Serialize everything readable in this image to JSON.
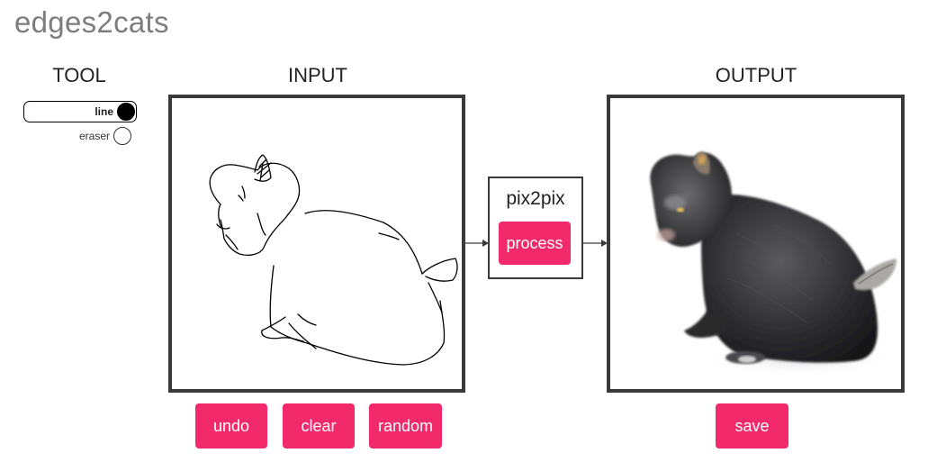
{
  "app": {
    "title": "edges2cats"
  },
  "tool": {
    "label": "TOOL",
    "options": [
      {
        "label": "line",
        "selected": true
      },
      {
        "label": "eraser",
        "selected": false
      }
    ]
  },
  "input": {
    "label": "INPUT",
    "buttons": {
      "undo": "undo",
      "clear": "clear",
      "random": "random"
    }
  },
  "model": {
    "label": "pix2pix",
    "process_button": "process"
  },
  "output": {
    "label": "OUTPUT",
    "save_button": "save"
  },
  "colors": {
    "accent": "#f22a6c",
    "frame": "#3a3a3a",
    "title": "#7d7d7d"
  },
  "icons": [
    "radio-filled-icon",
    "radio-empty-icon",
    "arrow-right-icon"
  ]
}
